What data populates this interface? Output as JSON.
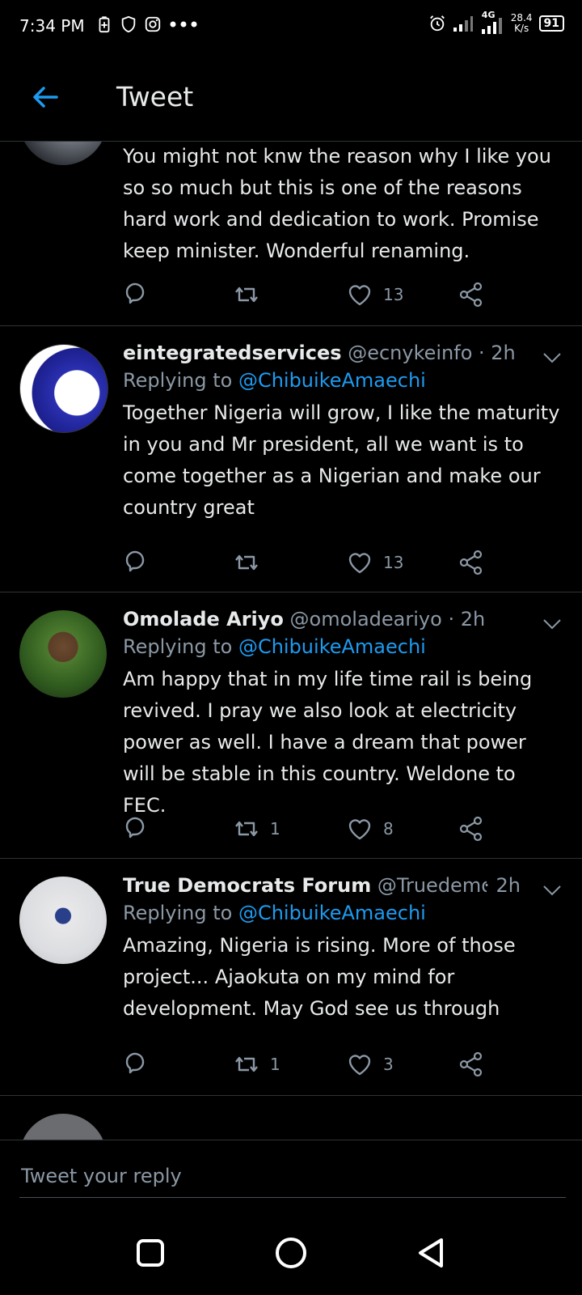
{
  "status": {
    "time": "7:34 PM",
    "network": "4G",
    "speed_value": "28.4",
    "speed_unit": "K/s",
    "battery": "91",
    "left_icons": [
      "battery-saver-icon",
      "shield-icon",
      "instagram-icon",
      "more-dots-icon"
    ],
    "right_icons": [
      "alarm-icon",
      "signal-icon",
      "signal-4g-icon"
    ]
  },
  "header": {
    "title": "Tweet",
    "back_icon": "back-arrow-icon"
  },
  "tweets": [
    {
      "text": "You might not knw the reason why I like you so so much but this is one of the reasons  hard work and dedication to work. Promise keep minister. Wonderful renaming.",
      "likes": "13",
      "retweets": ""
    },
    {
      "name": "eintegratedservices",
      "handle": "@ecnykeinfo",
      "time": "· 2h",
      "replying_prefix": "Replying to ",
      "replying_to": "@ChibuikeAmaechi",
      "text": "Together Nigeria will grow, I like the maturity in you and Mr president, all we want is to come together as a Nigerian and make our country great",
      "retweets": "",
      "likes": "13"
    },
    {
      "name": "Omolade Ariyo",
      "handle": "@omoladeariyo",
      "time": "· 2h",
      "replying_prefix": "Replying to ",
      "replying_to": "@ChibuikeAmaechi",
      "text": "Am happy that in my life time rail is being revived. I pray we also look at electricity power as well. I have a dream that power will be stable in this country. Weldone to FEC.",
      "retweets": "1",
      "likes": "8"
    },
    {
      "name": "True Democrats Forum",
      "handle": "@Truedemocr...",
      "time": "· 2h",
      "replying_prefix": "Replying to ",
      "replying_to": "@ChibuikeAmaechi",
      "text": "Amazing, Nigeria is rising. More of those project... Ajaokuta on my mind for development. May God see us through",
      "retweets": "1",
      "likes": "3"
    }
  ],
  "reply_box": {
    "placeholder": "Tweet your reply"
  },
  "nav": {
    "icons": [
      "recents-square-icon",
      "home-circle-icon",
      "back-triangle-icon"
    ]
  },
  "colors": {
    "accent": "#1d9bf0",
    "background": "#000000",
    "muted": "#8b98a5",
    "divider": "#2f3336"
  }
}
